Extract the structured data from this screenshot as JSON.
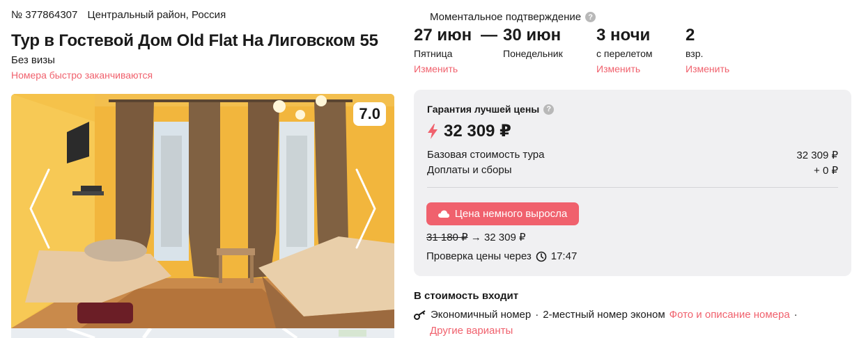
{
  "header": {
    "tour_number": "№ 377864307",
    "location": "Центральный район, Россия",
    "title": "Тур в Гостевой Дом Old Flat На Лиговском 55",
    "visa": "Без визы",
    "rooms_warning": "Номера быстро заканчиваются"
  },
  "gallery": {
    "rating": "7.0"
  },
  "booking": {
    "confirmation": "Моментальное подтверждение",
    "help_glyph": "?",
    "date_from": "27 июн",
    "dash": "—",
    "date_to": "30 июн",
    "day_from": "Пятница",
    "day_to": "Понедельник",
    "change_dates": "Изменить",
    "nights": "3 ночи",
    "nights_note": "с перелетом",
    "change_nights": "Изменить",
    "guests": "2",
    "guests_note": "взр.",
    "change_guests": "Изменить"
  },
  "price": {
    "guarantee_label": "Гарантия лучшей цены",
    "total": "32 309 ₽",
    "base_label": "Базовая стоимость тура",
    "base_value": "32 309 ₽",
    "fees_label": "Доплаты и сборы",
    "fees_value": "+ 0 ₽",
    "rise_badge": "Цена немного выросла",
    "old_price": "31 180 ₽",
    "arrow": "→",
    "new_price": "32 309 ₽",
    "check_label": "Проверка цены через",
    "check_time": "17:47"
  },
  "included": {
    "title": "В стоимость входит",
    "room_type": "Экономичный номер",
    "separator": "·",
    "room_desc": "2-местный номер эконом",
    "photo_link": "Фото и описание номера",
    "other_link": "Другие варианты"
  },
  "colors": {
    "accent": "#f0616d",
    "panel": "#f0f0f2"
  }
}
